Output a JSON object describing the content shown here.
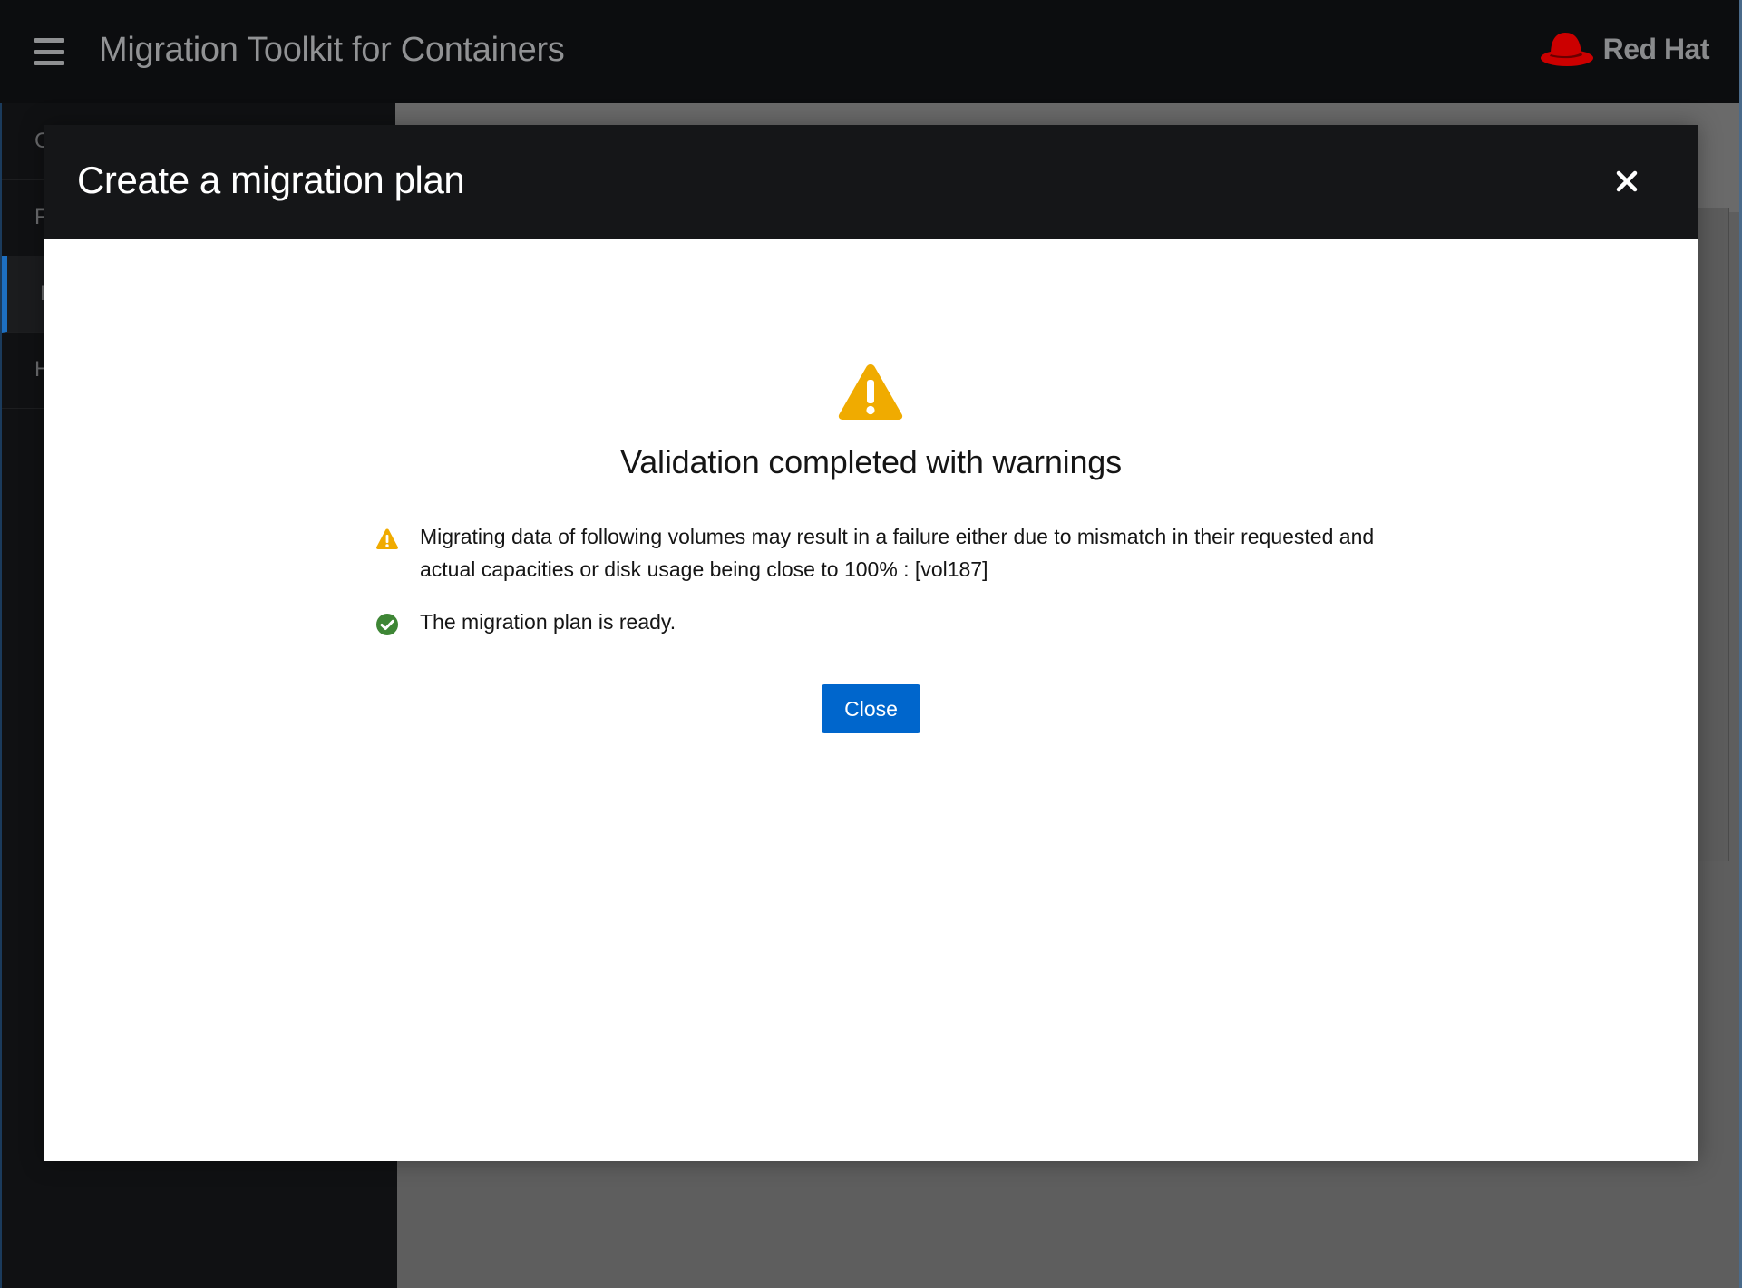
{
  "masthead": {
    "app_title": "Migration Toolkit for Containers",
    "brand": "Red Hat",
    "menu_icon": "hamburger-menu-icon",
    "logo_icon": "red-hat-fedora-logo"
  },
  "sidebar": {
    "items": [
      {
        "label": "C"
      },
      {
        "label": "R"
      },
      {
        "label": "M",
        "active": true
      },
      {
        "label": "H"
      }
    ]
  },
  "modal": {
    "title": "Create a migration plan",
    "close_icon": "close-icon",
    "status_icon": "warning-triangle-icon",
    "result_title": "Validation completed with warnings",
    "messages": [
      {
        "type": "warning",
        "icon": "warning-icon",
        "text": "Migrating data of following volumes may result in a failure either due to mismatch in their requested and actual capacities or disk usage being close to 100% : [vol187]"
      },
      {
        "type": "success",
        "icon": "check-circle-icon",
        "text": "The migration plan is ready."
      }
    ],
    "close_button": "Close"
  },
  "colors": {
    "masthead_bg": "#0c0d0f",
    "primary_button": "#0066cc",
    "warning": "#f0ab00",
    "success": "#3e8635",
    "logo_red": "#cc0000"
  }
}
